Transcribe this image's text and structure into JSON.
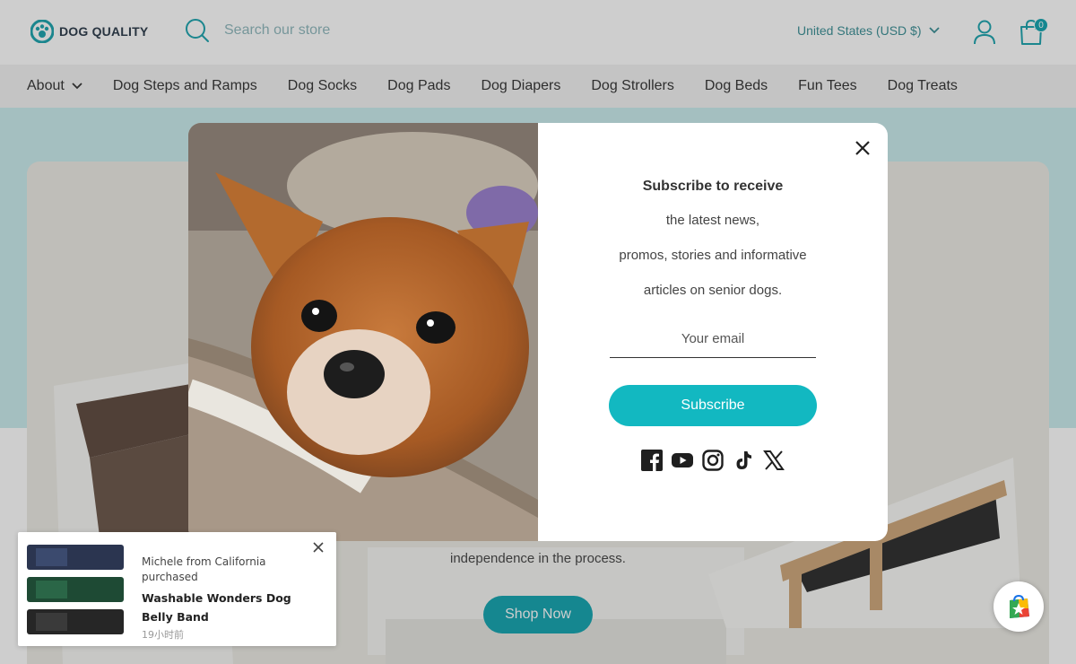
{
  "header": {
    "logo_text": "DOG QUALITY",
    "search_placeholder": "Search our store",
    "currency": "United States (USD $)",
    "cart_count": "0"
  },
  "nav": {
    "items": [
      {
        "label": "About",
        "has_dropdown": true
      },
      {
        "label": "Dog Steps and Ramps"
      },
      {
        "label": "Dog Socks"
      },
      {
        "label": "Dog Pads"
      },
      {
        "label": "Dog Diapers"
      },
      {
        "label": "Dog Strollers"
      },
      {
        "label": "Dog Beds"
      },
      {
        "label": "Fun Tees"
      },
      {
        "label": "Dog Treats"
      }
    ]
  },
  "hero": {
    "text": "independence in the process.",
    "cta_label": "Shop Now"
  },
  "modal": {
    "title": "Subscribe to receive",
    "lines": [
      "the latest news,",
      "promos, stories and informative",
      "articles on senior dogs."
    ],
    "email_placeholder": "Your email",
    "subscribe_label": "Subscribe",
    "socials": [
      "facebook-icon",
      "youtube-icon",
      "instagram-icon",
      "tiktok-icon",
      "x-icon"
    ]
  },
  "purchase_popup": {
    "buyer": "Michele from California purchased",
    "product": "Washable Wonders Dog Belly Band",
    "time": "19小时前"
  },
  "colors": {
    "accent": "#12a5b0",
    "teal_band": "#c9ecee",
    "nav_bg": "#f2f2f2"
  }
}
